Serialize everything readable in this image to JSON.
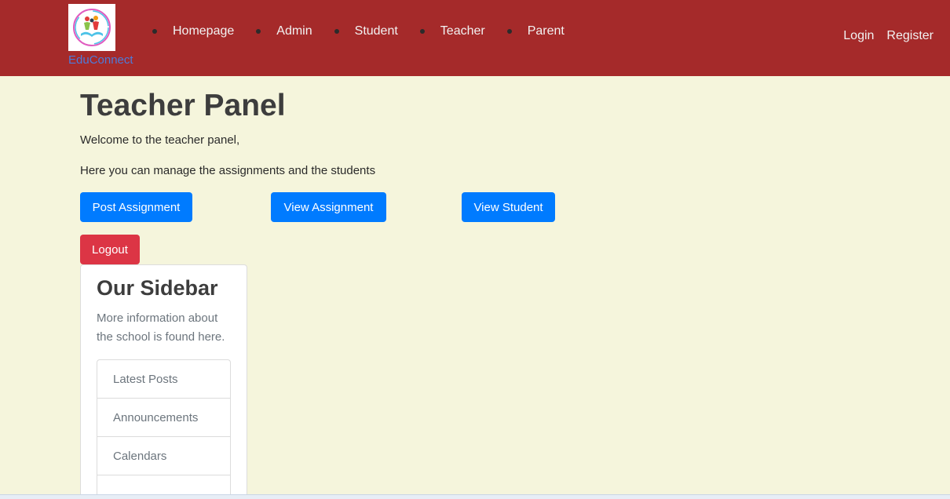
{
  "brand": {
    "name": "EduConnect",
    "logo_icon": "educonnect-logo-icon"
  },
  "nav": {
    "items": [
      {
        "label": "Homepage"
      },
      {
        "label": "Admin"
      },
      {
        "label": "Student"
      },
      {
        "label": "Teacher"
      },
      {
        "label": "Parent"
      }
    ],
    "login": "Login",
    "register": "Register"
  },
  "main": {
    "title": "Teacher Panel",
    "welcome": "Welcome to the teacher panel,",
    "description": "Here you can manage the assignments and the students",
    "buttons": {
      "post_assignment": "Post Assignment",
      "view_assignment": "View Assignment",
      "view_student": "View Student",
      "logout": "Logout"
    }
  },
  "sidebar": {
    "title": "Our Sidebar",
    "text": "More information about the school is found here.",
    "items": [
      {
        "label": "Latest Posts"
      },
      {
        "label": "Announcements"
      },
      {
        "label": "Calendars"
      },
      {
        "label": ""
      }
    ]
  },
  "colors": {
    "navbar": "#a52a2a",
    "page_background": "#f5f5dc",
    "primary": "#007bff",
    "danger": "#dc3545",
    "brand_text": "#4d7bd9"
  }
}
